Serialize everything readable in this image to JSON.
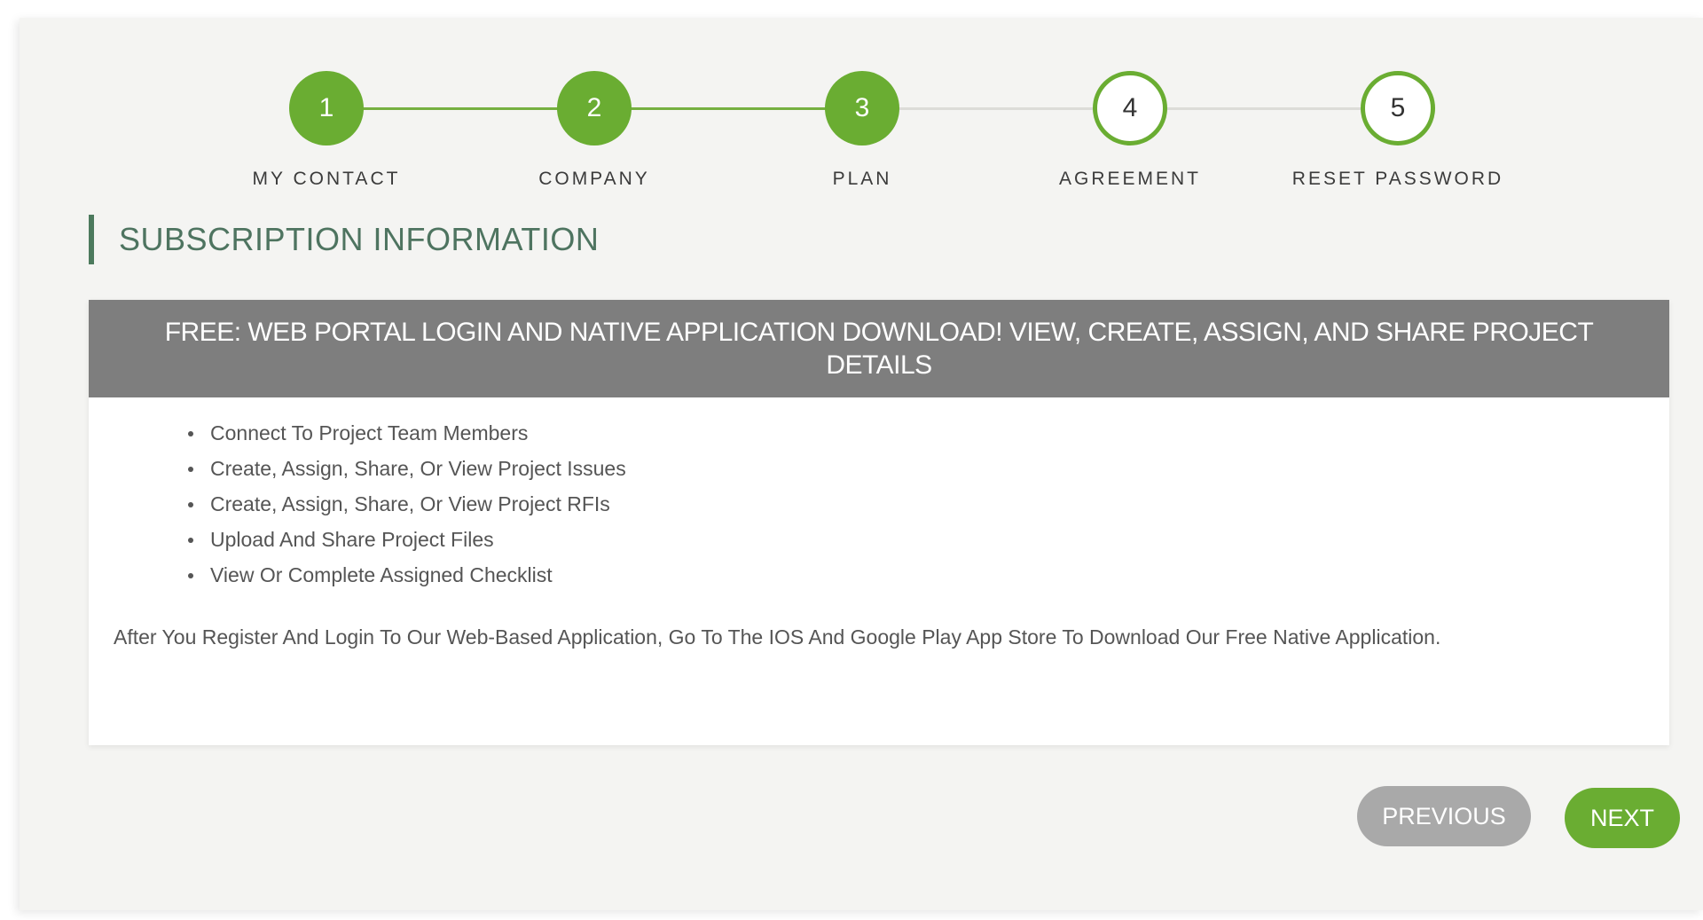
{
  "stepper": {
    "steps": [
      {
        "number": "1",
        "label": "MY CONTACT",
        "status": "complete"
      },
      {
        "number": "2",
        "label": "COMPANY",
        "status": "complete"
      },
      {
        "number": "3",
        "label": "PLAN",
        "status": "current"
      },
      {
        "number": "4",
        "label": "AGREEMENT",
        "status": "pending"
      },
      {
        "number": "5",
        "label": "RESET PASSWORD",
        "status": "pending"
      }
    ]
  },
  "section": {
    "title": "SUBSCRIPTION INFORMATION"
  },
  "plan": {
    "header": "FREE: WEB PORTAL LOGIN AND NATIVE APPLICATION DOWNLOAD! VIEW, CREATE, ASSIGN, AND SHARE PROJECT DETAILS",
    "features": [
      "Connect To Project Team Members",
      "Create, Assign, Share, Or View Project Issues",
      "Create, Assign, Share, Or View Project RFIs",
      "Upload And Share Project Files",
      "View Or Complete Assigned Checklist"
    ],
    "note": "After You Register And Login To Our Web-Based Application, Go To The IOS And Google Play App Store To Download Our Free Native Application."
  },
  "actions": {
    "previous_label": "PREVIOUS",
    "next_label": "NEXT"
  },
  "colors": {
    "accent_green": "#6aad32",
    "header_gray": "#7e7e7e",
    "title_green": "#4e7460",
    "disabled_gray": "#a9a9a9"
  }
}
